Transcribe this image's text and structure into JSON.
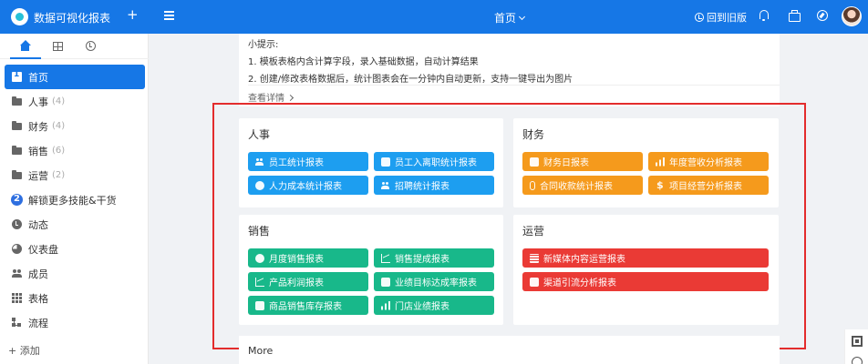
{
  "header": {
    "app_title": "数据可视化报表",
    "page_title": "首页",
    "back_old_label": "回到旧版"
  },
  "sidebar": {
    "items": [
      {
        "label": "首页",
        "count": ""
      },
      {
        "label": "人事",
        "count": "(4)"
      },
      {
        "label": "财务",
        "count": "(4)"
      },
      {
        "label": "销售",
        "count": "(6)"
      },
      {
        "label": "运营",
        "count": "(2)"
      },
      {
        "label": "解锁更多技能&干货",
        "count": ""
      },
      {
        "label": "动态",
        "count": ""
      },
      {
        "label": "仪表盘",
        "count": ""
      },
      {
        "label": "成员",
        "count": ""
      },
      {
        "label": "表格",
        "count": ""
      },
      {
        "label": "流程",
        "count": ""
      }
    ],
    "add_label": "+ 添加"
  },
  "tips": {
    "title": "小提示:",
    "line1": "1. 模板表格内含计算字段，录入基础数据，自动计算结果",
    "line2": "2. 创建/修改表格数据后，统计图表会在一分钟内自动更新，支持一键导出为图片",
    "more": "查看详情"
  },
  "cards": {
    "hr": {
      "title": "人事",
      "buttons": [
        "员工统计报表",
        "员工入离职统计报表",
        "人力成本统计报表",
        "招聘统计报表"
      ]
    },
    "finance": {
      "title": "财务",
      "buttons": [
        "财务日报表",
        "年度营收分析报表",
        "合同收款统计报表",
        "项目经营分析报表"
      ]
    },
    "sales": {
      "title": "销售",
      "buttons": [
        "月度销售报表",
        "销售提成报表",
        "产品利润报表",
        "业绩目标达成率报表",
        "商品销售库存报表",
        "门店业绩报表"
      ]
    },
    "ops": {
      "title": "运营",
      "buttons": [
        "新媒体内容运营报表",
        "渠道引流分析报表"
      ]
    }
  },
  "more_section": {
    "title": "More"
  },
  "colors": {
    "primary": "#1677e6",
    "hr_button": "#1d9ef0",
    "finance_button": "#f59a1c",
    "sales_button": "#18b88a",
    "ops_button": "#ea3a35",
    "highlight_border": "#e32c2c"
  }
}
